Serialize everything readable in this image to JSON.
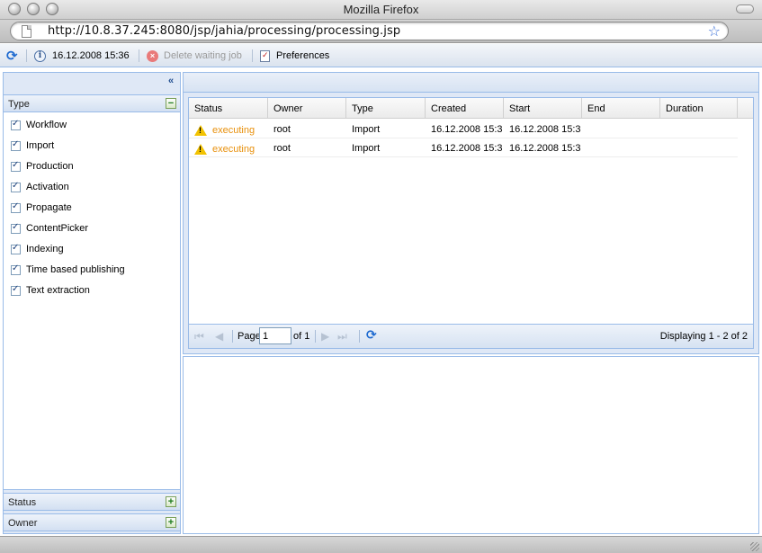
{
  "window": {
    "title": "Mozilla Firefox",
    "url": "http://10.8.37.245:8080/jsp/jahia/processing/processing.jsp"
  },
  "toolbar": {
    "timestamp": "16.12.2008 15:36",
    "delete_label": "Delete waiting job",
    "preferences_label": "Preferences"
  },
  "sidebar": {
    "collapse_glyph": "«",
    "type_header": "Type",
    "type_items": [
      {
        "label": "Workflow",
        "checked": true
      },
      {
        "label": "Import",
        "checked": true
      },
      {
        "label": "Production",
        "checked": true
      },
      {
        "label": "Activation",
        "checked": true
      },
      {
        "label": "Propagate",
        "checked": true
      },
      {
        "label": "ContentPicker",
        "checked": true
      },
      {
        "label": "Indexing",
        "checked": true
      },
      {
        "label": "Time based publishing",
        "checked": true
      },
      {
        "label": "Text extraction",
        "checked": true
      }
    ],
    "status_header": "Status",
    "owner_header": "Owner"
  },
  "grid": {
    "columns": [
      "Status",
      "Owner",
      "Type",
      "Created",
      "Start",
      "End",
      "Duration"
    ],
    "rows": [
      {
        "status": "executing",
        "owner": "root",
        "type": "Import",
        "created": "16.12.2008 15:3",
        "start": "16.12.2008 15:3",
        "end": "",
        "duration": ""
      },
      {
        "status": "executing",
        "owner": "root",
        "type": "Import",
        "created": "16.12.2008 15:3",
        "start": "16.12.2008 15:3",
        "end": "",
        "duration": ""
      }
    ],
    "status_color": "#e8900c"
  },
  "pager": {
    "page_label": "Page",
    "page_value": "1",
    "of_label": "of 1",
    "displaying": "Displaying 1 - 2 of 2"
  },
  "colors": {
    "panel_border": "#99bbe8",
    "panel_bg": "#dfe8f6",
    "link_blue": "#1e6ad0"
  }
}
